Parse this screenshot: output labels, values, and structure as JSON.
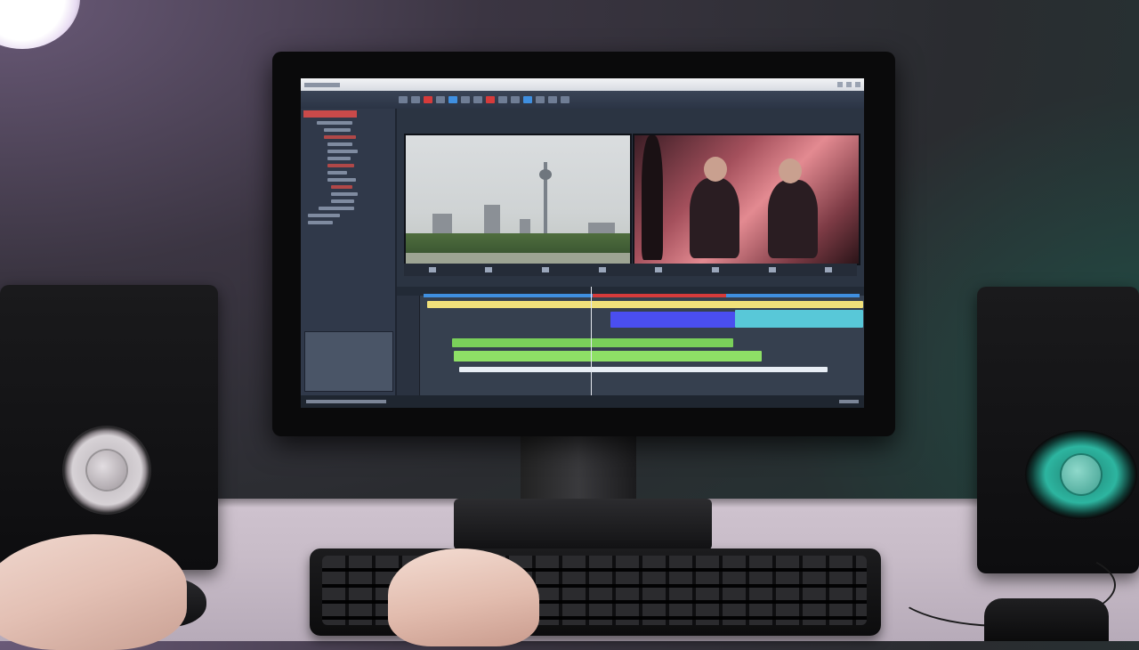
{
  "scene": {
    "description_colors": {
      "wall_left": "#3b3542",
      "wall_right": "#1f3a36",
      "desk": "#cfc3cf",
      "screen_bg": "#2b3442"
    }
  },
  "editor": {
    "window_controls": [
      "minimize-icon",
      "maximize-icon",
      "close-icon"
    ],
    "timeline": {
      "track_colors": [
        "#f0e07a",
        "#4a5cf0",
        "#58c8d8",
        "#7ad05a",
        "#e8eef5"
      ],
      "marker_colors": [
        "#d63b3b",
        "#3f8fe0",
        "#ff8f3a"
      ]
    }
  }
}
